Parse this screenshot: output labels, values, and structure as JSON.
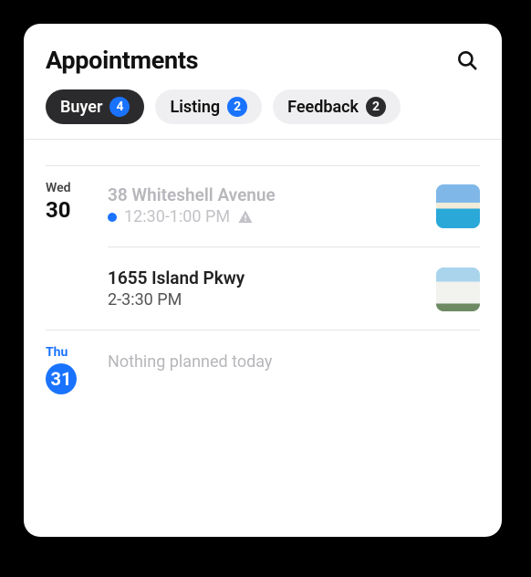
{
  "header": {
    "title": "Appointments"
  },
  "tabs": [
    {
      "label": "Buyer",
      "count": "4",
      "active": true,
      "badgeColor": "blue"
    },
    {
      "label": "Listing",
      "count": "2",
      "active": false,
      "badgeColor": "blue"
    },
    {
      "label": "Feedback",
      "count": "2",
      "active": false,
      "badgeColor": "dark"
    }
  ],
  "days": [
    {
      "weekday": "Wed",
      "daynum": "30",
      "today": false,
      "events": [
        {
          "title": "38 Whiteshell Avenue",
          "time": "12:30-1:00 PM",
          "past": true,
          "dot": true,
          "warn": true,
          "thumb": "pool"
        },
        {
          "title": "1655 Island Pkwy",
          "time": "2-3:30 PM",
          "past": false,
          "dot": false,
          "warn": false,
          "thumb": "house"
        }
      ]
    },
    {
      "weekday": "Thu",
      "daynum": "31",
      "today": true,
      "empty": "Nothing planned today"
    }
  ]
}
